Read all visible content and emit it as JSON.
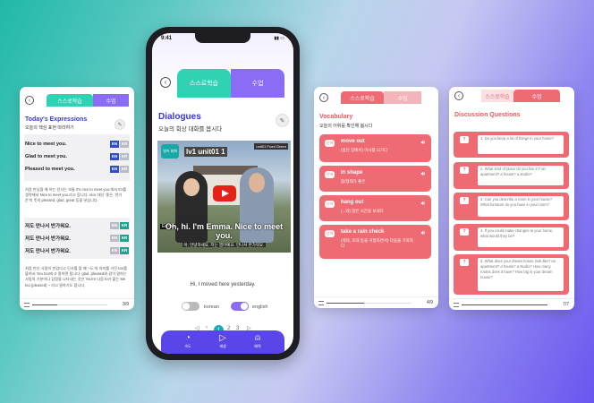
{
  "colors": {
    "purple": "#5a46e8",
    "teal": "#1fa38f",
    "coral": "#ef6b73",
    "mint": "#2fd3b4",
    "lilac": "#8a6cf5"
  },
  "card1": {
    "tab_active": "스스로학습",
    "tab_inactive": "수업",
    "title": "Today's Expressions",
    "subtitle": "오늘의 핵심 표현 따라하기",
    "rows": [
      {
        "text": "Nice to meet you.",
        "en": "EN",
        "kr": "KR"
      },
      {
        "text": "Glad to meet you.",
        "en": "EN",
        "kr": "KR"
      },
      {
        "text": "Pleased to meet you.",
        "en": "EN",
        "kr": "KR"
      }
    ],
    "para1": "처음 만났을 때 하는 인사는 보통 It's nice to meet you.에서 It's를 생략해서 Nice to meet you.라고 합니다. nice 대신 '좋은, 반가운'의 뜻의 pleased, glad, great 등을 넣습니다.",
    "rows2": [
      {
        "text": "저도 만나서 반가워요.",
        "en": "EN",
        "kr": "KR"
      },
      {
        "text": "저도 만나서 반가워요.",
        "en": "EN",
        "kr": "KR"
      },
      {
        "text": "저도 만나서 반가워요.",
        "en": "EN",
        "kr": "KR"
      }
    ],
    "para2": "처음 만난 사람이 반갑다고 인사를 할 때 '~도'의 의미를 가진 too를 붙여서 You too!라고 말하면 됩니다. glad, pleased와 같이 말하는 사람의 기분이나 감정을 나타내는 것은 You're 다음 to가 붙는 Me too (pleased) ~ 라고 말하기도 합니다.",
    "page": "3/9"
  },
  "phone": {
    "time": "9:41",
    "tab_active": "스스로학습",
    "tab_inactive": "수업",
    "title": "Dialogues",
    "subtitle": "오늘의 회상 대화를 봅시다",
    "video": {
      "logo": "영어 회화",
      "title": "lv1 unit01 1",
      "tag": "unit01 Front Green",
      "caption": "Oh, hi. I'm Emma. Nice to meet you.",
      "caption_kr": "아, 안녕하세요. 저는 엠마예요. 만나서 반가워요.",
      "speaker": "Emma"
    },
    "sentence": "Hi, I moved here yesterday.",
    "toggle_left": "korean",
    "toggle_right": "english",
    "page_current": "1",
    "page_next": "2",
    "page_next2": "3",
    "nav": [
      {
        "icon": "speedometer-icon",
        "label": "속도"
      },
      {
        "icon": "play-icon",
        "label": "재생"
      },
      {
        "icon": "add-user-icon",
        "label": "배역"
      }
    ]
  },
  "card3": {
    "tab_active": "스스로학습",
    "tab_inactive": "수업",
    "title": "Vocabulary",
    "subtitle": "오늘의 어휘를 확인해 봅시다",
    "items": [
      {
        "tag": "단어",
        "word": "move out",
        "meaning": "(살던 집에서) 이사를 나가다"
      },
      {
        "tag": "단어",
        "word": "in shape",
        "meaning": "몸/형태가 좋은"
      },
      {
        "tag": "단어",
        "word": "hang out",
        "meaning": "(...와) 많은 시간을 보내다"
      },
      {
        "tag": "단어",
        "word": "take a rain check",
        "meaning": "(제의, 초대 등을 거절하면서) 다음을 기약하다"
      }
    ],
    "page": "4/9"
  },
  "card4": {
    "tab_active": "스스로학습",
    "tab_inactive": "수업",
    "title": "Discussion Questions",
    "questions": [
      "1. Do you keep a lot of things in your home?",
      "2. What kind of place do you live in? an apartment? a house? a studio?",
      "3. Can you describe a room in your house? What furniture do you have in your room?",
      "4. If you could make changes to your home, what would they be?",
      "5. What does your dream house look like? an apartment? a house? a studio? How many rooms does it have? How big is your dream house?"
    ],
    "page": "7/7"
  }
}
